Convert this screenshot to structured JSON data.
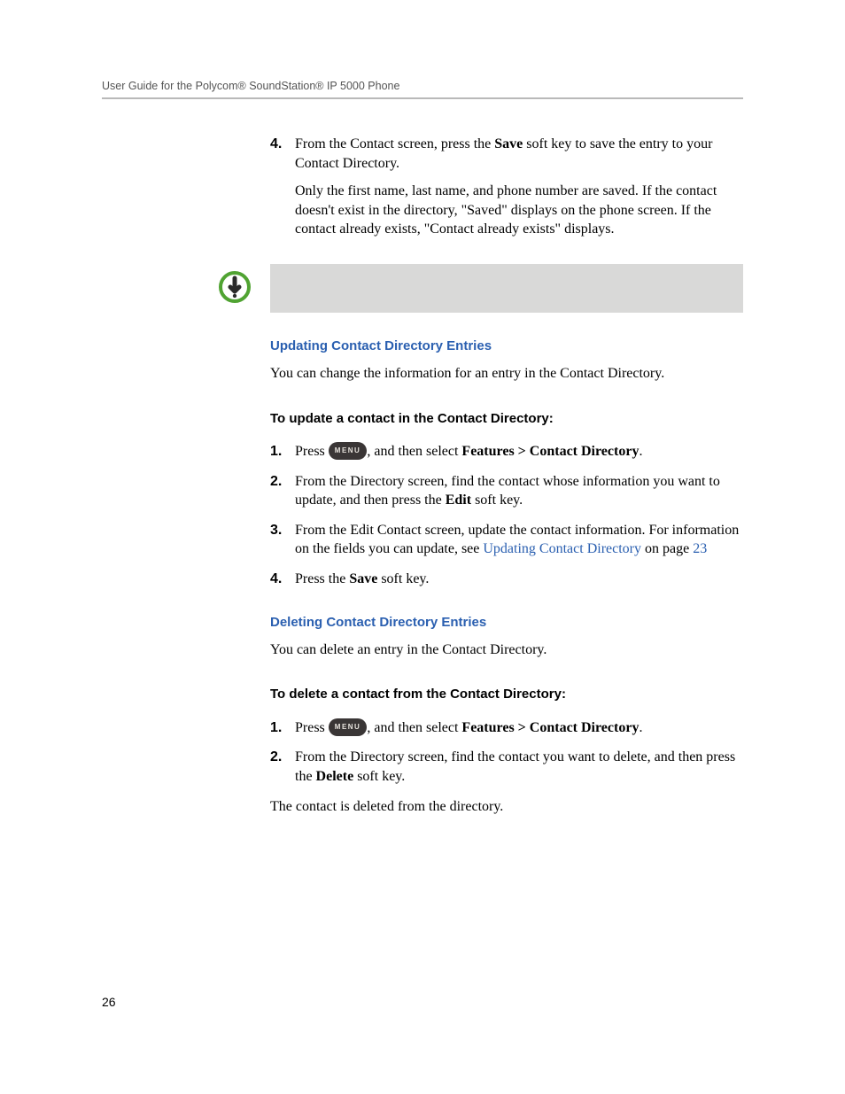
{
  "header": "User Guide for the Polycom® SoundStation® IP 5000 Phone",
  "step4": {
    "num": "4.",
    "line1_a": "From the Contact screen, press the ",
    "line1_b": "Save",
    "line1_c": " soft key to save the entry to your Contact Directory.",
    "line2": "Only the first name, last name, and phone number are saved. If the contact doesn't exist in the directory, \"Saved\" displays on the phone screen. If the contact already exists, \"Contact already exists\" displays."
  },
  "sectionA": {
    "heading": "Updating Contact Directory Entries",
    "intro": "You can change the information for an entry in the Contact Directory.",
    "procHeading": "To update a contact in the Contact Directory:",
    "s1num": "1.",
    "s1a": "Press ",
    "s1b": ", and then select ",
    "s1c": "Features > Contact Directory",
    "s1d": ".",
    "s2num": "2.",
    "s2a": "From the Directory screen, find the contact whose information you want to update, and then press the ",
    "s2b": "Edit",
    "s2c": " soft key.",
    "s3num": "3.",
    "s3a": "From the Edit Contact screen, update the contact information. For information on the fields you can update, see ",
    "s3link": "Updating Contact Directory",
    "s3b": " on page ",
    "s3page": "23",
    "s4num": "4.",
    "s4a": "Press the ",
    "s4b": "Save",
    "s4c": " soft key."
  },
  "sectionB": {
    "heading": "Deleting Contact Directory Entries",
    "intro": "You can delete an entry in the Contact Directory.",
    "procHeading": "To delete a contact from the Contact Directory:",
    "s1num": "1.",
    "s1a": "Press ",
    "s1b": ", and then select ",
    "s1c": "Features > Contact Directory",
    "s1d": ".",
    "s2num": "2.",
    "s2a": "From the Directory screen, find the contact you want to delete, and then press the ",
    "s2b": "Delete",
    "s2c": " soft key.",
    "outro": "The contact is deleted from the directory."
  },
  "menuLabel": "MENU",
  "pageNumber": "26"
}
